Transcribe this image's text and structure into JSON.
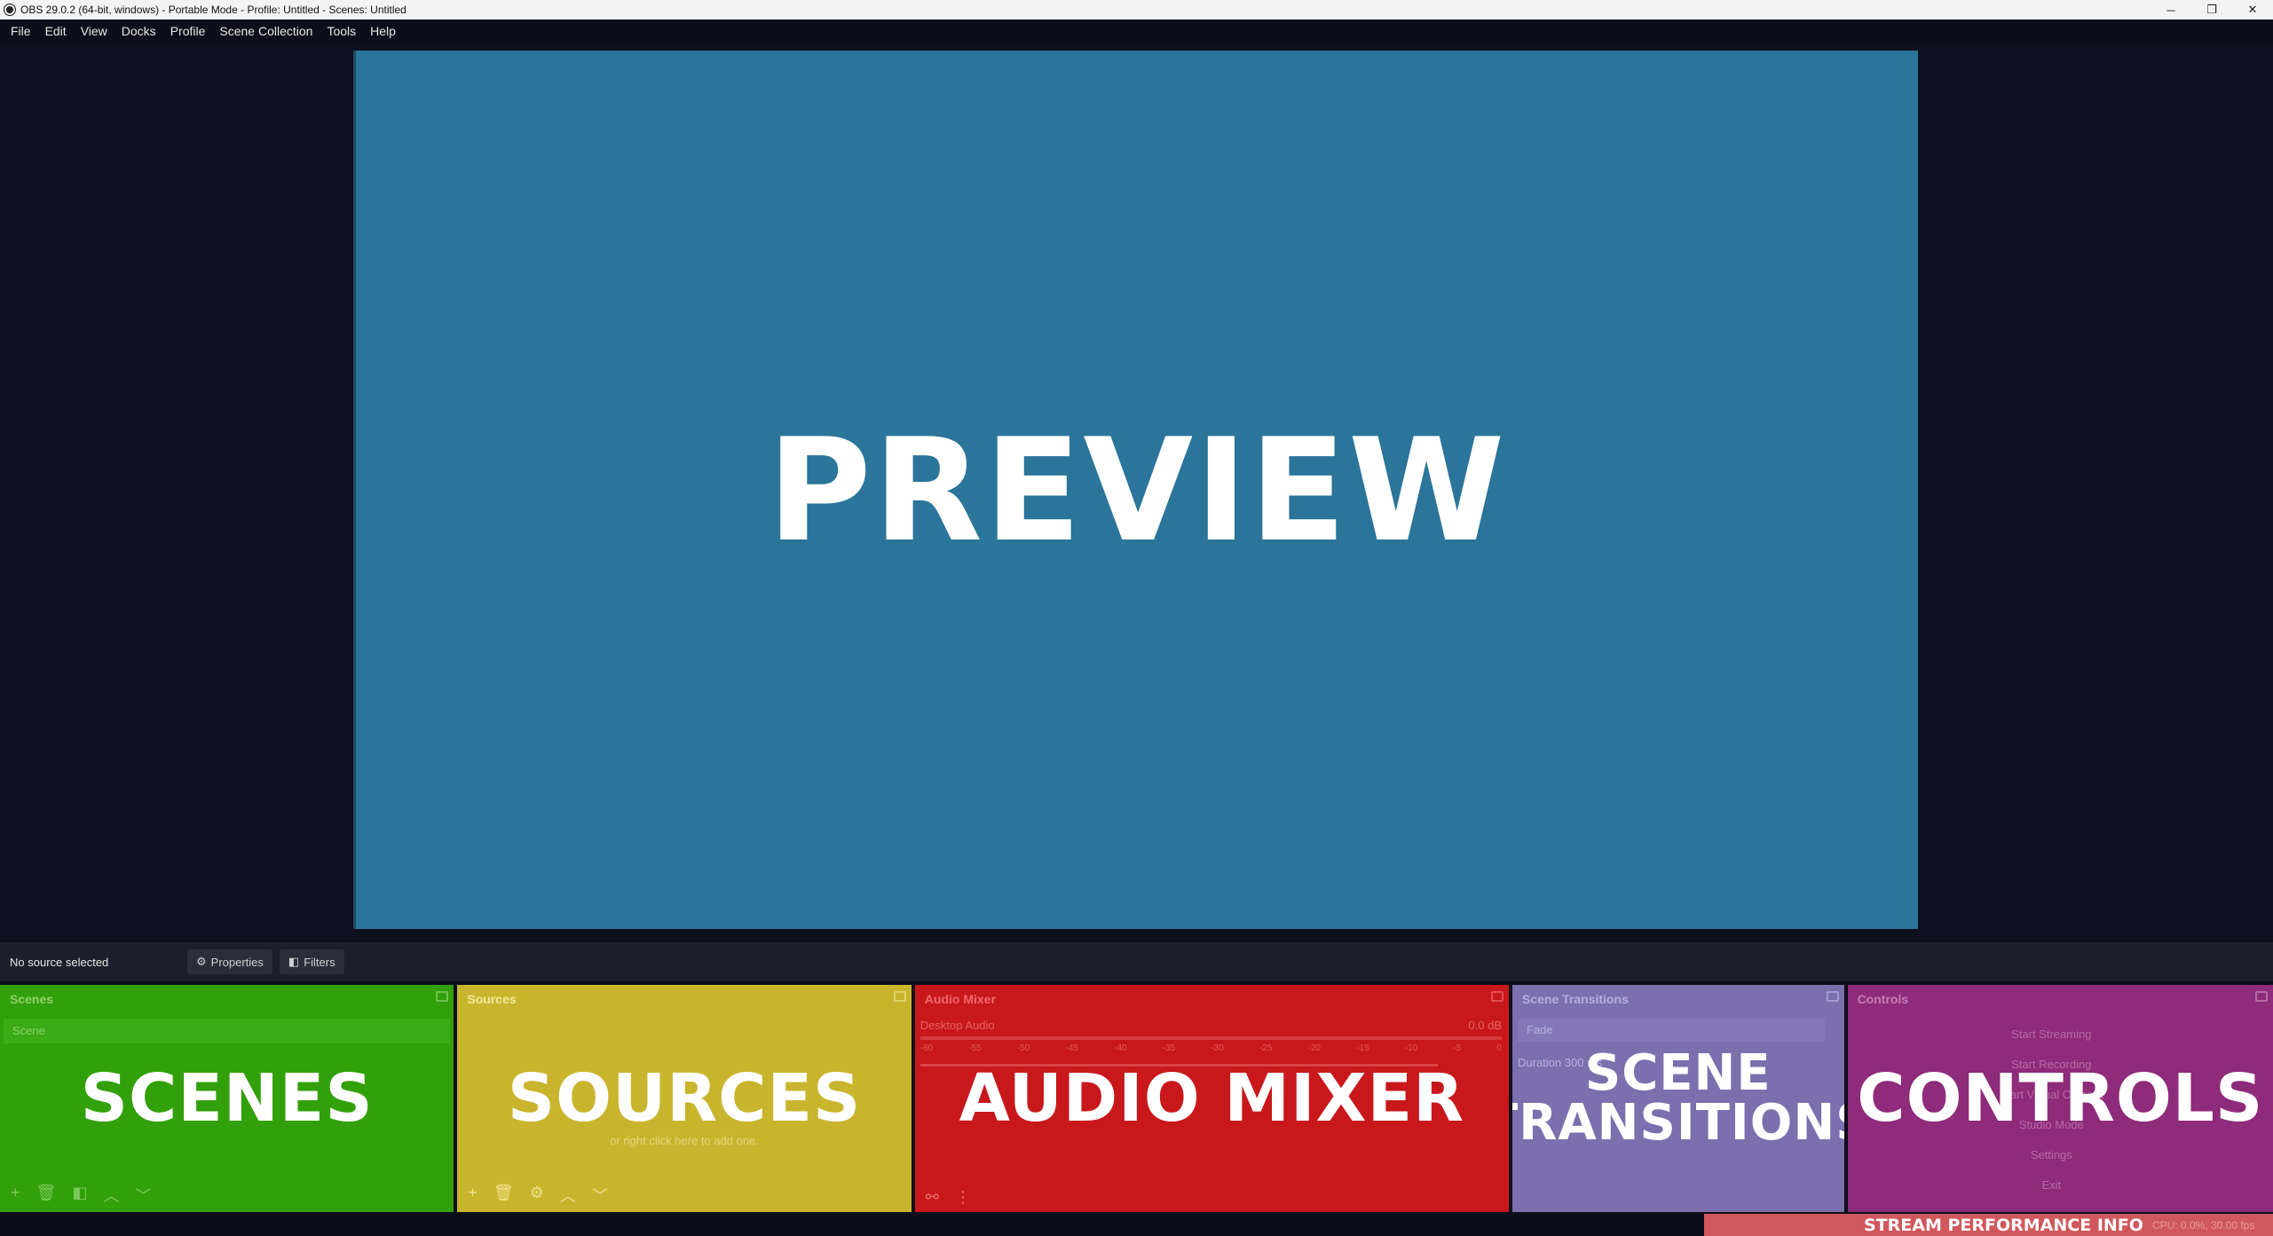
{
  "window": {
    "title": "OBS 29.0.2 (64-bit, windows) - Portable Mode - Profile: Untitled - Scenes: Untitled",
    "minimize": "─",
    "maximize": "❐",
    "close": "✕"
  },
  "menu": {
    "items": [
      "File",
      "Edit",
      "View",
      "Docks",
      "Profile",
      "Scene Collection",
      "Tools",
      "Help"
    ]
  },
  "preview": {
    "label": "PREVIEW",
    "background": "#2a7599"
  },
  "source_toolbar": {
    "status": "No source selected",
    "properties_label": "Properties",
    "filters_label": "Filters"
  },
  "docks": {
    "scenes": {
      "title": "Scenes",
      "label": "SCENES",
      "items": [
        "Scene"
      ],
      "color": "#32a00b"
    },
    "sources": {
      "title": "Sources",
      "label": "SOURCES",
      "empty_hint": "or right click here to add one.",
      "color": "#c9b52d"
    },
    "audio": {
      "title": "Audio Mixer",
      "label": "AUDIO MIXER",
      "channel": "Desktop Audio",
      "level": "0.0 dB",
      "scale": [
        "-60",
        "-55",
        "-50",
        "-45",
        "-40",
        "-35",
        "-30",
        "-25",
        "-20",
        "-15",
        "-10",
        "-5",
        "0"
      ],
      "color": "#c8181c"
    },
    "transitions": {
      "title": "Scene Transitions",
      "label_line1": "SCENE",
      "label_line2": "TRANSITIONS",
      "transition": "Fade",
      "duration_label": "Duration",
      "duration_value": "300 ms",
      "color": "#7b6fad"
    },
    "controls": {
      "title": "Controls",
      "label": "CONTROLS",
      "buttons": [
        "Start Streaming",
        "Start Recording",
        "Start Virtual Camera",
        "Studio Mode",
        "Settings",
        "Exit"
      ],
      "color": "#8e2b7a"
    }
  },
  "status": {
    "label": "STREAM PERFORMANCE INFO",
    "stats": "CPU: 0.0%, 30.00 fps",
    "color": "#d0585c"
  }
}
